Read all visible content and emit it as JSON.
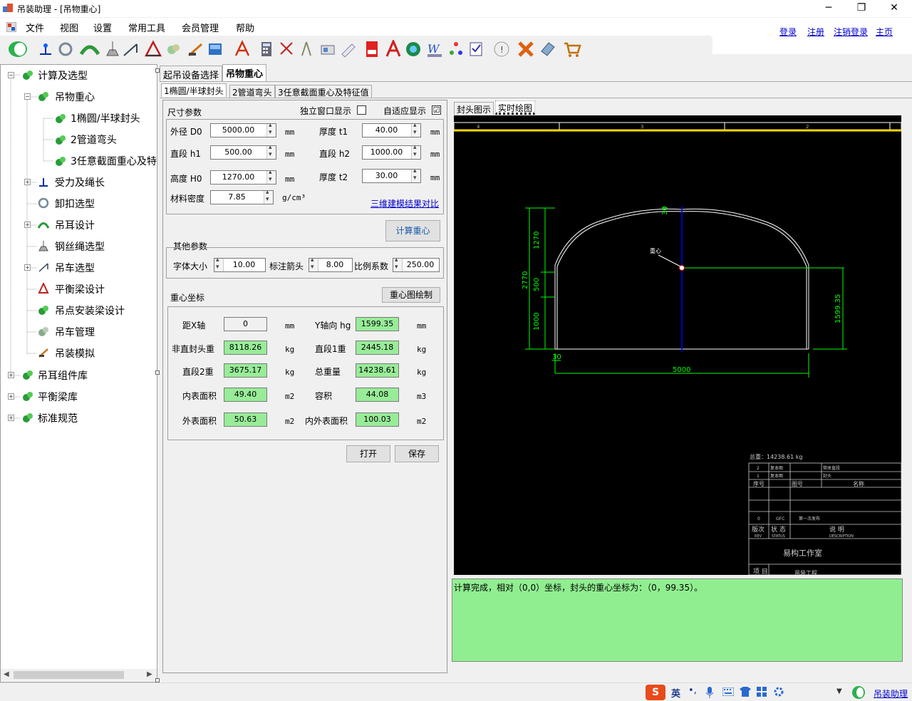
{
  "window": {
    "title": "吊装助理 - [吊物重心]",
    "minimize": "─",
    "maximize": "❐",
    "close": "✕"
  },
  "menu": {
    "items": [
      "文件",
      "视图",
      "设置",
      "常用工具",
      "会员管理",
      "帮助"
    ],
    "links": [
      "登录",
      "注册",
      "注销登录",
      "主页"
    ]
  },
  "tree": {
    "root1": "计算及选型",
    "child1": "吊物重心",
    "sub1": "1椭圆/半球封头",
    "sub2": "2管道弯头",
    "sub3": "3任意截面重心及特",
    "c2": "受力及绳长",
    "c3": "卸扣选型",
    "c4": "吊耳设计",
    "c5": "钢丝绳选型",
    "c6": "吊车选型",
    "c7": "平衡梁设计",
    "c8": "吊点安装梁设计",
    "c9": "吊车管理",
    "c10": "吊装模拟",
    "root2": "吊耳组件库",
    "root3": "平衡梁库",
    "root4": "标准规范"
  },
  "tabs": {
    "main": [
      "起吊设备选择",
      "吊物重心"
    ],
    "sub": [
      "1椭圆/半球封头",
      "2管道弯头",
      "3任意截面重心及特征值"
    ],
    "right": [
      "封头图示",
      "实时绘图"
    ]
  },
  "dims": {
    "title": "尺寸参数",
    "independent": "独立窗口显示",
    "adaptive": "自适应显示",
    "checked": "☑",
    "D0_label": "外径 D0",
    "D0": "5000.00",
    "t1_label": "厚度 t1",
    "t1": "40.00",
    "h1_label": "直段 h1",
    "h1": "500.00",
    "h2_label": "直段 h2",
    "h2": "1000.00",
    "H0_label": "高度 H0",
    "H0": "1270.00",
    "t2_label": "厚度 t2",
    "t2": "30.00",
    "rho_label": "材料密度",
    "rho": "7.85",
    "rho_unit": "g/cm³",
    "unit_mm": "mm",
    "link3d": "三维建模结果对比",
    "calc_btn": "计算重心"
  },
  "other": {
    "title": "其他参数",
    "font_label": "字体大小",
    "font": "10.00",
    "arrow_label": "标注箭头",
    "arrow": "8.00",
    "scale_label": "比例系数",
    "scale": "250.00"
  },
  "cog": {
    "title": "重心坐标",
    "draw_btn": "重心图绘制",
    "dx_label": "距X轴",
    "dx": "0",
    "dx_unit": "mm",
    "y_label": "Y轴向 hg",
    "y": "1599.35",
    "y_unit": "mm",
    "nh_label": "非直封头重",
    "nh": "8118.26",
    "kg": "kg",
    "s1_label": "直段1重",
    "s1": "2445.18",
    "s2_label": "直段2重",
    "s2": "3675.17",
    "tot_label": "总重量",
    "tot": "14238.61",
    "ia_label": "内表面积",
    "ia": "49.40",
    "m2": "m2",
    "vol_label": "容积",
    "vol": "44.08",
    "m3": "m3",
    "oa_label": "外表面积",
    "oa": "50.63",
    "ioa_label": "内外表面积",
    "ioa": "100.03",
    "open_btn": "打开",
    "save_btn": "保存"
  },
  "drawing": {
    "ruler": [
      "4",
      "3",
      "2"
    ],
    "dim_top": "30",
    "dim_1270": "1270",
    "dim_500": "500",
    "dim_1000": "1000",
    "dim_2770": "2770",
    "dim_bottom": "30",
    "dim_5000": "5000",
    "dim_right": "1599.35",
    "cog_label": "重心",
    "total_weight": "总重：14238.61 kg",
    "tb_rows": [
      [
        "2",
        "复本图",
        "筒体直段"
      ],
      [
        "1",
        "复本图",
        "封头"
      ]
    ],
    "tb_hdr": [
      "序号",
      "图号",
      "名称"
    ],
    "tb_rev": [
      "0",
      "GFC",
      "第一次发布"
    ],
    "tb_rev_hdr": [
      "版次",
      "状 态",
      "说    明"
    ],
    "tb_rev_en": [
      "REV",
      "STATUS",
      "DESCRIPTION"
    ],
    "studio": "易构工作室",
    "project": "项  目",
    "project_val": "吊装工程"
  },
  "log": "计算完成，相对（0,0）坐标，封头的重心坐标为：（0，99.35）。",
  "status": {
    "ime": "英",
    "app": "吊装助理"
  },
  "colors": {
    "green": "#98ec98",
    "cad_green": "#00ff00",
    "cad_blue": "#0000ff",
    "link": "#0000cc"
  }
}
